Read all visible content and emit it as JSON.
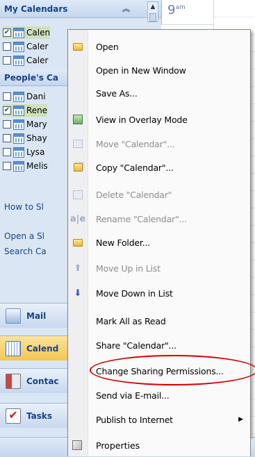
{
  "nav": {
    "my_calendars_header": "My Calendars",
    "time_label_hour": "9",
    "time_label_suffix": "am",
    "my_calendars": [
      {
        "label": "Calen",
        "checked": true
      },
      {
        "label": "Caler",
        "checked": false
      },
      {
        "label": "Caler",
        "checked": false
      }
    ],
    "peoples_header": "People's Ca",
    "people_calendars": [
      {
        "label": "Dani",
        "checked": false
      },
      {
        "label": "Rene",
        "checked": true
      },
      {
        "label": "Mary",
        "checked": false
      },
      {
        "label": "Shay",
        "checked": false
      },
      {
        "label": "Lysa",
        "checked": false
      },
      {
        "label": "Melis",
        "checked": false
      }
    ],
    "links": [
      "How to Sl",
      "Open a Sl",
      "Search Ca"
    ],
    "buttons": [
      {
        "label": "Mail",
        "icon": "mail-icon"
      },
      {
        "label": "Calend",
        "icon": "calendar-icon",
        "active": true
      },
      {
        "label": "Contac",
        "icon": "contacts-icon"
      },
      {
        "label": "Tasks",
        "icon": "tasks-icon"
      }
    ]
  },
  "menu": {
    "items": [
      {
        "label": "Open",
        "icon": "open-folder-icon",
        "disabled": false
      },
      {
        "label": "Open in New Window",
        "icon": "",
        "disabled": false
      },
      {
        "label": "Save As...",
        "icon": "",
        "disabled": false
      },
      {
        "label": "View in Overlay Mode",
        "icon": "overlay-icon",
        "disabled": false
      },
      {
        "label": "Move \"Calendar\"...",
        "icon": "move-icon",
        "disabled": true
      },
      {
        "label": "Copy \"Calendar\"...",
        "icon": "copy-icon",
        "disabled": false
      },
      {
        "label": "Delete \"Calendar\"",
        "icon": "delete-icon",
        "disabled": true
      },
      {
        "label": "Rename \"Calendar\"...",
        "icon": "rename-icon",
        "disabled": true
      },
      {
        "label": "New Folder...",
        "icon": "new-folder-icon",
        "disabled": false
      },
      {
        "label": "Move Up in List",
        "icon": "arrow-up-icon",
        "disabled": true
      },
      {
        "label": "Move Down in List",
        "icon": "arrow-down-icon",
        "disabled": false
      },
      {
        "label": "Mark All as Read",
        "icon": "",
        "disabled": false
      },
      {
        "label": "Share \"Calendar\"...",
        "icon": "",
        "disabled": false
      },
      {
        "label": "Change Sharing Permissions...",
        "icon": "",
        "disabled": false,
        "highlighted": true
      },
      {
        "label": "Send via E-mail...",
        "icon": "",
        "disabled": false
      },
      {
        "label": "Publish to Internet",
        "icon": "",
        "disabled": false,
        "submenu": true
      },
      {
        "label": "Properties",
        "icon": "properties-icon",
        "disabled": false
      }
    ]
  },
  "colors": {
    "nav_bg": "#dbe6f4",
    "header_text": "#15428b",
    "active_button": "#f6c453",
    "highlight_ring": "#d80000"
  }
}
